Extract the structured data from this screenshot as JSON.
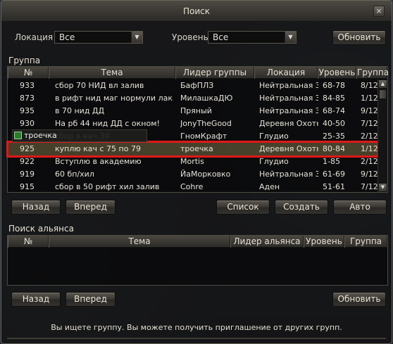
{
  "window": {
    "title": "Поиск",
    "close_label": "×"
  },
  "filters": {
    "location_label": "Локация",
    "location_value": "Все",
    "level_label": "Уровень",
    "level_value": "Все",
    "refresh_label": "Обновить"
  },
  "groups": {
    "section_label": "Группа",
    "columns": [
      "№",
      "Тема",
      "Лидер группы",
      "Локация",
      "Уровень",
      "Группа"
    ],
    "rows": [
      {
        "num": "933",
        "topic": "сбор 70 НИД вл залив",
        "leader": "БафПЛЗ",
        "location": "Нейтральная З",
        "level": "68-78",
        "group": "8/12"
      },
      {
        "num": "873",
        "topic": "в рифт нид маг нормули лак",
        "leader": "МилашкаДЮ",
        "location": "Нейтральная З",
        "level": "84-85",
        "group": "1/12"
      },
      {
        "num": "935",
        "topic": "в 70 нид ДД",
        "leader": "Пряный",
        "location": "Нейтральная З",
        "level": "68-74",
        "group": "9/12"
      },
      {
        "num": "930",
        "topic": "На рб 44 нид ДД с окном!",
        "leader": "JonyTheGood",
        "location": "Деревня Охотн",
        "level": "40-50",
        "group": "7/12"
      },
      {
        "num": "",
        "topic": "сбор в кач 39",
        "leader": "ГномКрафт",
        "location": "Глудио",
        "level": "25-35",
        "group": "2/12"
      },
      {
        "num": "925",
        "topic": "куплю кач с 75 по 79",
        "leader": "троечка",
        "location": "Деревня Охотн",
        "level": "80-84",
        "group": "1/12"
      },
      {
        "num": "922",
        "topic": "Вступлю в академию",
        "leader": "Mortis",
        "location": "Глудио",
        "level": "1-85",
        "group": "2/12"
      },
      {
        "num": "919",
        "topic": "60   бп/хил",
        "leader": "ЙаМорковко",
        "location": "Нейтральная З",
        "level": "61-69",
        "group": "9/12"
      },
      {
        "num": "915",
        "topic": "сбор в 50 рифт хил залив",
        "leader": "Cohre",
        "location": "Аден",
        "level": "51-61",
        "group": "7/12"
      }
    ],
    "selected_index": 5,
    "tooltip_text": "троечка",
    "buttons": {
      "back": "Назад",
      "forward": "Вперед",
      "list": "Список",
      "create": "Создать",
      "auto": "Авто"
    }
  },
  "alliances": {
    "section_label": "Поиск альянса",
    "columns": [
      "№",
      "Тема",
      "Лидер альянса",
      "Уровень",
      "Группа"
    ],
    "rows": [],
    "buttons": {
      "back": "Назад",
      "forward": "Вперед",
      "refresh": "Обновить"
    }
  },
  "status": {
    "message": "Вы ищете группу. Вы можете получить приглашение от других групп."
  },
  "colors": {
    "highlight_border": "#e01818",
    "selected_row": "#786e46"
  }
}
